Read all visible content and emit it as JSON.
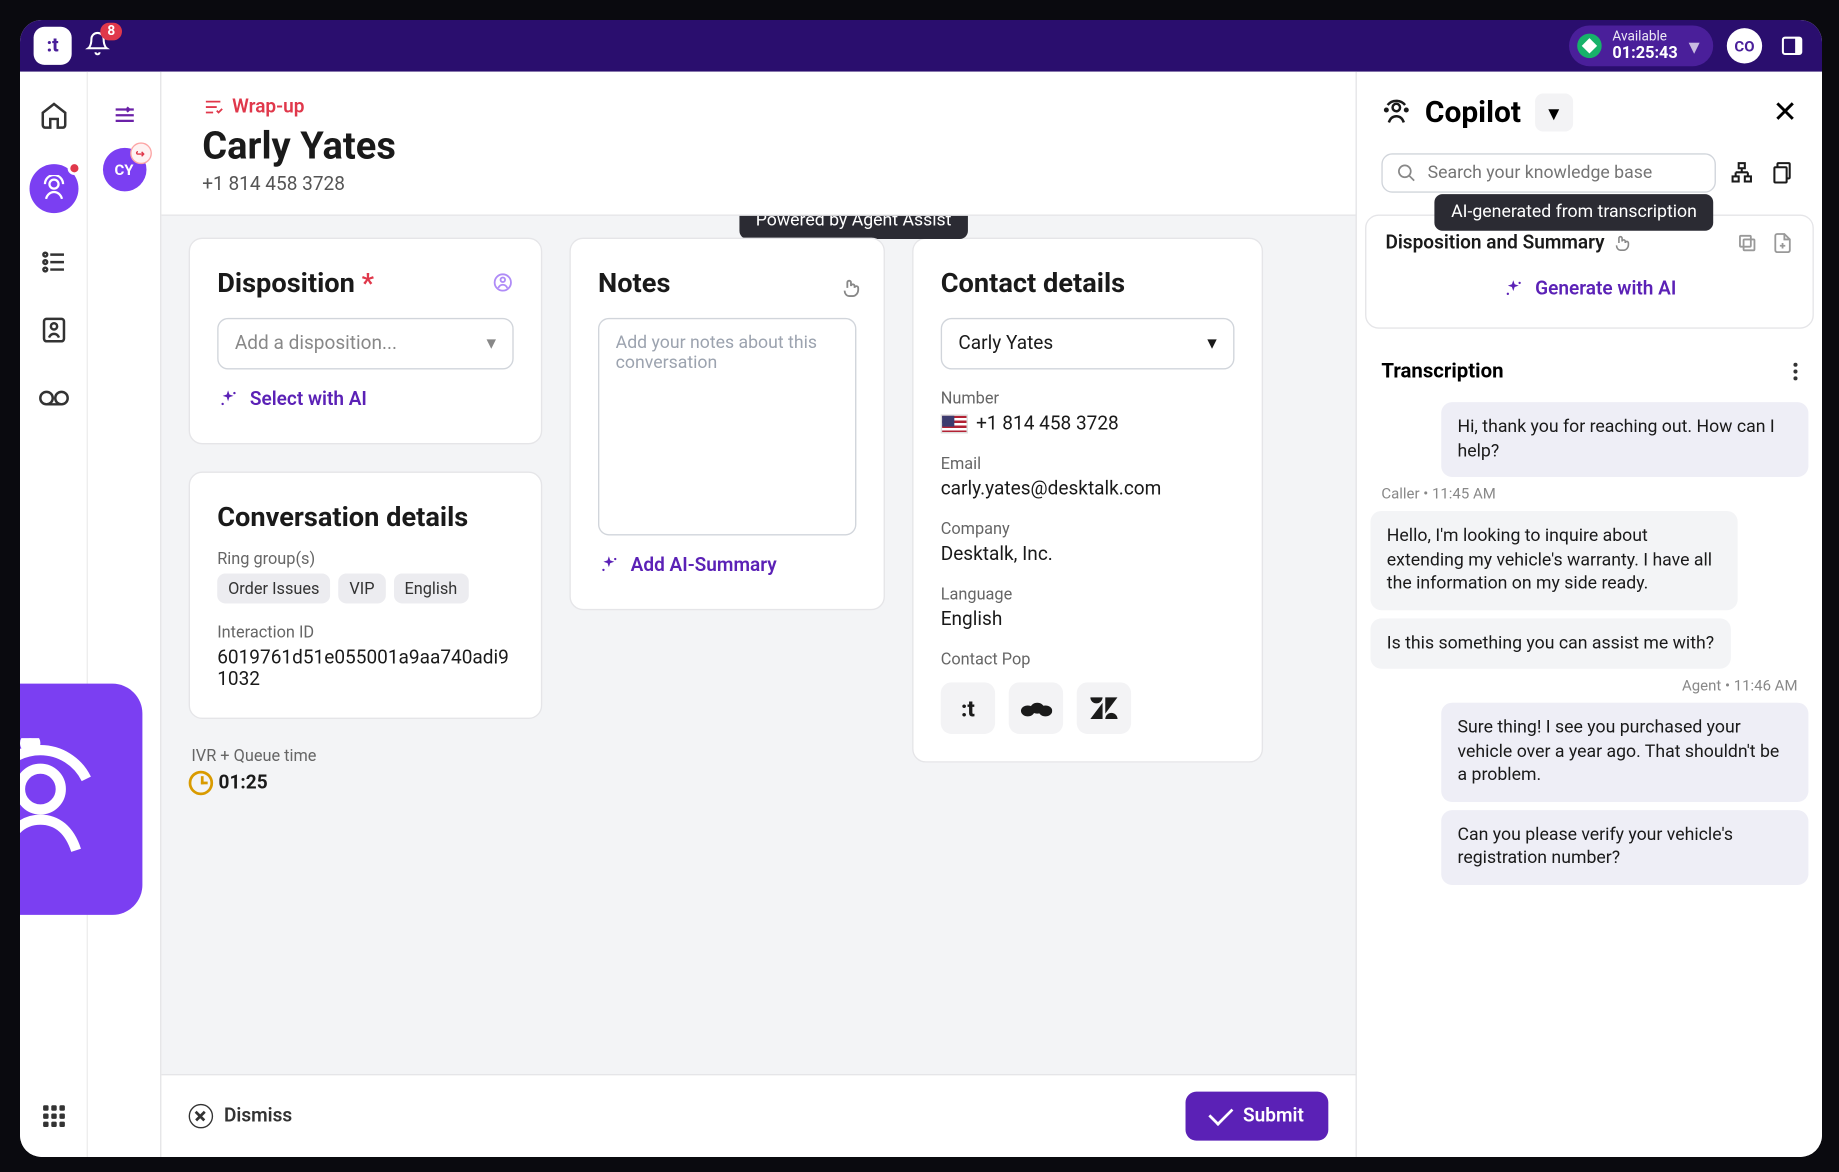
{
  "topbar": {
    "logo": ":t",
    "notifications": "8",
    "status_label": "Available",
    "status_time": "01:25:43",
    "agent_initials": "CO"
  },
  "convo_rail": {
    "avatar_initials": "CY"
  },
  "header": {
    "wrapup_label": "Wrap-up",
    "name": "Carly Yates",
    "phone": "+1 814 458 3728"
  },
  "tooltip_agent_assist": "Powered by Agent Assist",
  "disposition": {
    "title": "Disposition",
    "required": "*",
    "placeholder": "Add a disposition...",
    "ai_link": "Select with AI"
  },
  "conversation_details": {
    "title": "Conversation details",
    "ring_groups_label": "Ring group(s)",
    "chips": [
      "Order Issues",
      "VIP",
      "English"
    ],
    "interaction_id_label": "Interaction ID",
    "interaction_id": "6019761d51e055001a9aa740adi91032",
    "ivr_label": "IVR + Queue time",
    "ivr_time": "01:25"
  },
  "notes": {
    "title": "Notes",
    "placeholder": "Add your notes about this conversation",
    "ai_link": "Add AI-Summary"
  },
  "contact": {
    "title": "Contact details",
    "selected": "Carly Yates",
    "number_label": "Number",
    "number": "+1 814 458 3728",
    "email_label": "Email",
    "email": "carly.yates@desktalk.com",
    "company_label": "Company",
    "company": "Desktalk, Inc.",
    "language_label": "Language",
    "language": "English",
    "pop_label": "Contact Pop",
    "pop_tiles": [
      ":t",
      "sf",
      "zd"
    ]
  },
  "actions": {
    "dismiss": "Dismiss",
    "submit": "Submit"
  },
  "copilot": {
    "title": "Copilot",
    "search_placeholder": "Search your knowledge base",
    "ai_tooltip": "AI-generated from transcription",
    "disposition_summary_label": "Disposition and Summary",
    "generate_label": "Generate with AI",
    "transcription_label": "Transcription",
    "messages": [
      {
        "role": "agent",
        "text": "Hi, thank you for reaching out. How can I help?"
      },
      {
        "meta": "Caller  •  11:45 AM"
      },
      {
        "role": "caller",
        "text": "Hello, I'm looking to inquire about extending my vehicle's warranty. I have all the information on my side ready."
      },
      {
        "role": "caller",
        "text": "Is this something you can assist me with?"
      },
      {
        "meta": "Agent  •  11:46 AM",
        "right": true
      },
      {
        "role": "agent",
        "text": "Sure thing! I see you purchased your vehicle over a year ago. That shouldn't be a problem."
      },
      {
        "role": "agent",
        "text": "Can you please verify your vehicle's registration number?"
      }
    ]
  }
}
